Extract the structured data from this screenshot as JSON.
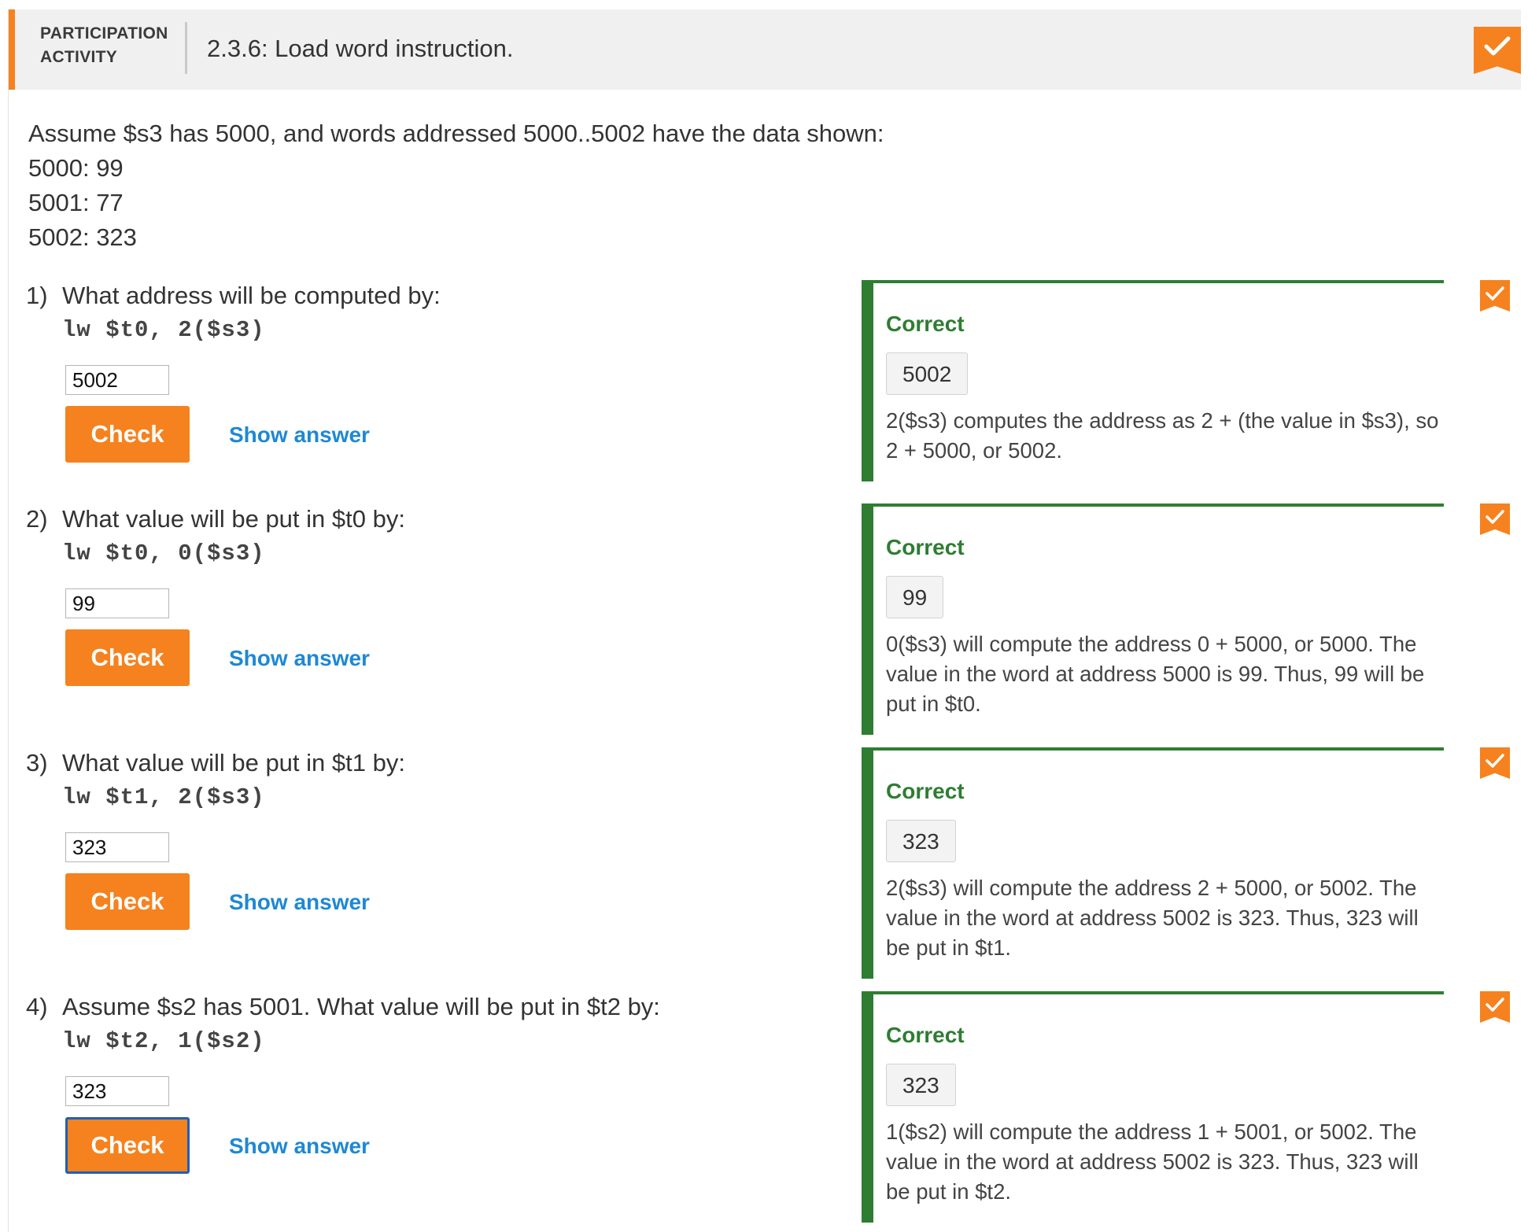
{
  "header": {
    "participation_line1": "PARTICIPATION",
    "participation_line2": "ACTIVITY",
    "activity_title": "2.3.6: Load word instruction.",
    "completion_icon": "checkmark-icon",
    "accent_color": "#f5821f"
  },
  "intro": {
    "lines": [
      "Assume $s3 has 5000, and words addressed 5000..5002 have the data shown:",
      "5000: 99",
      "5001: 77",
      "5002: 323"
    ]
  },
  "questions": [
    {
      "number": "1)",
      "prompt": "What address will be computed by:",
      "code": "lw $t0, 2($s3)",
      "input_value": "5002",
      "check_label": "Check",
      "show_answer_label": "Show answer",
      "feedback_status": "Correct",
      "feedback_answer": "5002",
      "feedback_explanation": "2($s3) computes the address as 2 + (the value in $s3), so 2 + 5000, or 5002."
    },
    {
      "number": "2)",
      "prompt": "What value will be put in $t0 by:",
      "code": "lw $t0, 0($s3)",
      "input_value": "99",
      "check_label": "Check",
      "show_answer_label": "Show answer",
      "feedback_status": "Correct",
      "feedback_answer": "99",
      "feedback_explanation": "0($s3) will compute the address 0 + 5000, or 5000. The value in the word at address 5000 is 99. Thus, 99 will be put in $t0."
    },
    {
      "number": "3)",
      "prompt": "What value will be put in $t1 by:",
      "code": "lw $t1, 2($s3)",
      "input_value": "323",
      "check_label": "Check",
      "show_answer_label": "Show answer",
      "feedback_status": "Correct",
      "feedback_answer": "323",
      "feedback_explanation": "2($s3) will compute the address 2 + 5000, or 5002. The value in the word at address 5002 is 323. Thus, 323 will be put in $t1."
    },
    {
      "number": "4)",
      "prompt": "Assume $s2 has 5001. What value will be put in $t2 by:",
      "code": "lw $t2, 1($s2)",
      "input_value": "323",
      "check_label": "Check",
      "show_answer_label": "Show answer",
      "feedback_status": "Correct",
      "feedback_answer": "323",
      "feedback_explanation": "1($s2) will compute the address 1 + 5001, or 5002. The value in the word at address 5002 is 323. Thus, 323 will be put in $t2."
    }
  ],
  "colors": {
    "correct_green": "#2e7d32",
    "link_blue": "#1e88d4",
    "button_orange": "#f5821f"
  }
}
